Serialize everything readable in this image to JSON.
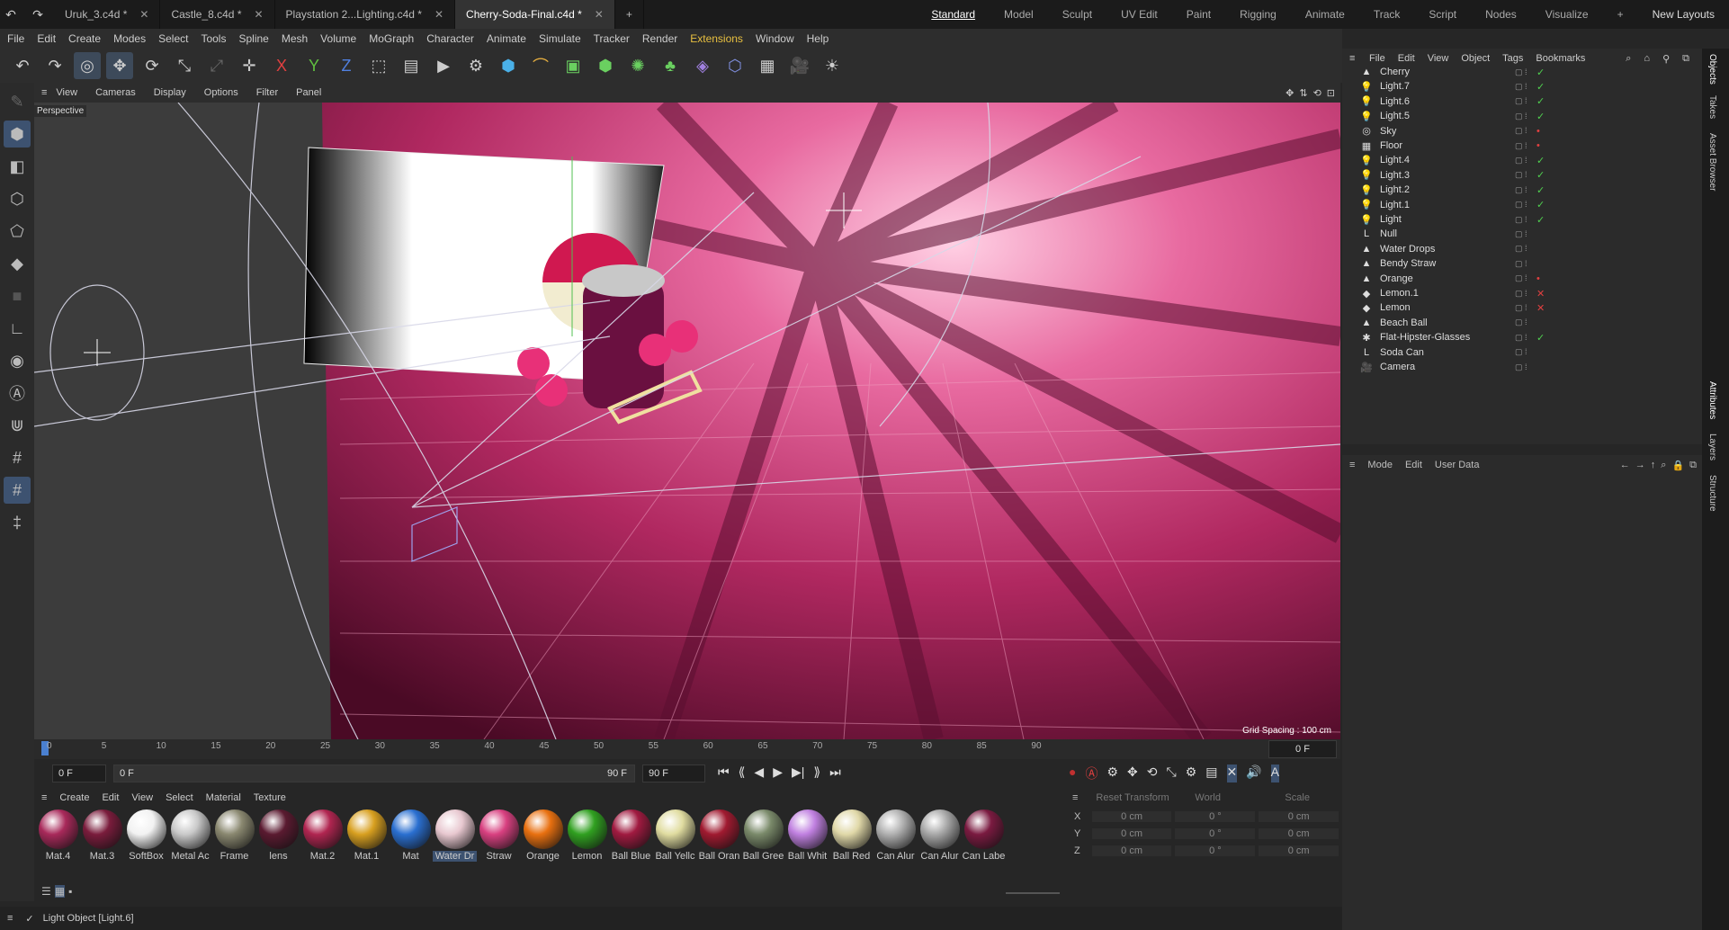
{
  "tabs": [
    {
      "label": "Uruk_3.c4d *"
    },
    {
      "label": "Castle_8.c4d *"
    },
    {
      "label": "Playstation 2...Lighting.c4d *"
    },
    {
      "label": "Cherry-Soda-Final.c4d *",
      "active": true
    }
  ],
  "layouts": [
    "Standard",
    "Model",
    "Sculpt",
    "UV Edit",
    "Paint",
    "Rigging",
    "Animate",
    "Track",
    "Script",
    "Nodes",
    "Visualize"
  ],
  "new_layouts": "New Layouts",
  "menu": [
    "File",
    "Edit",
    "Create",
    "Modes",
    "Select",
    "Tools",
    "Spline",
    "Mesh",
    "Volume",
    "MoGraph",
    "Character",
    "Animate",
    "Simulate",
    "Tracker",
    "Render",
    "Extensions",
    "Window",
    "Help"
  ],
  "toolbar_icons": [
    "undo-icon",
    "redo-icon",
    "live-select-icon",
    "move-icon",
    "rotate-icon",
    "scale-icon",
    "transform-icon",
    "axis-x-icon",
    "axis-y-icon",
    "axis-z-icon",
    "coordinate-system-icon",
    "render-view-icon",
    "render-picture-viewer-icon",
    "render-settings-icon",
    "cube-icon",
    "bend-icon",
    "subdivision-icon",
    "extrude-icon",
    "mograph-cloner-icon",
    "mograph-fracture-icon",
    "deformer-icon",
    "effector-icon",
    "grid-icon",
    "camera-icon",
    "light-icon"
  ],
  "viewport": {
    "menu": [
      "View",
      "Cameras",
      "Display",
      "Options",
      "Filter",
      "Panel"
    ],
    "camera_label": "Perspective",
    "grid_spacing": "Grid Spacing : 100 cm"
  },
  "timeline": {
    "ticks": [
      "0",
      "5",
      "10",
      "15",
      "20",
      "25",
      "30",
      "35",
      "40",
      "45",
      "50",
      "55",
      "60",
      "65",
      "70",
      "75",
      "80",
      "85",
      "90"
    ],
    "current": "0 F",
    "start": "0 F",
    "range_start": "0 F",
    "range_end": "90 F",
    "end": "90 F"
  },
  "material_menu": [
    "Create",
    "Edit",
    "View",
    "Select",
    "Material",
    "Texture"
  ],
  "materials": [
    {
      "label": "Mat.4",
      "color": "#a8295a"
    },
    {
      "label": "Mat.3",
      "color": "#7a1c3c"
    },
    {
      "label": "SoftBox",
      "color": "#f2f2f2"
    },
    {
      "label": "Metal Ac",
      "color": "#c9c9c9"
    },
    {
      "label": "Frame",
      "color": "#8a8870"
    },
    {
      "label": "lens",
      "color": "#5a1a30"
    },
    {
      "label": "Mat.2",
      "color": "#b02550"
    },
    {
      "label": "Mat.1",
      "color": "#d8a020"
    },
    {
      "label": "Mat",
      "color": "#2a6fd0"
    },
    {
      "label": "Water Dr",
      "color": "#e8c8d0"
    },
    {
      "label": "Straw",
      "color": "#d84080"
    },
    {
      "label": "Orange",
      "color": "#e87010"
    },
    {
      "label": "Lemon",
      "color": "#30a020"
    },
    {
      "label": "Ball Blue",
      "color": "#a01a40"
    },
    {
      "label": "Ball Yellc",
      "color": "#e0dca0"
    },
    {
      "label": "Ball Oran",
      "color": "#a01a30"
    },
    {
      "label": "Ball Gree",
      "color": "#7a8a6a"
    },
    {
      "label": "Ball Whit",
      "color": "#c080e0"
    },
    {
      "label": "Ball Red",
      "color": "#e0d8a8"
    },
    {
      "label": "Can Alur",
      "color": "#b0b0b0"
    },
    {
      "label": "Can Alur",
      "color": "#a8a8a8"
    },
    {
      "label": "Can Labe",
      "color": "#7a1a40"
    }
  ],
  "coords": {
    "reset": "Reset Transform",
    "world": "World",
    "scale": "Scale",
    "rows": [
      {
        "axis": "X",
        "p": "0 cm",
        "r": "0 °",
        "s": "0 cm"
      },
      {
        "axis": "Y",
        "p": "0 cm",
        "r": "0 °",
        "s": "0 cm"
      },
      {
        "axis": "Z",
        "p": "0 cm",
        "r": "0 °",
        "s": "0 cm"
      }
    ]
  },
  "status": "Light Object [Light.6]",
  "objects_menu": [
    "File",
    "Edit",
    "View",
    "Object",
    "Tags",
    "Bookmarks"
  ],
  "objects": [
    {
      "name": "Cherry",
      "icon": "▲",
      "tag": "check"
    },
    {
      "name": "Light.7",
      "icon": "💡",
      "tag": "check"
    },
    {
      "name": "Light.6",
      "icon": "💡",
      "tag": "check"
    },
    {
      "name": "Light.5",
      "icon": "💡",
      "tag": "check"
    },
    {
      "name": "Sky",
      "icon": "◎",
      "tag": "dot"
    },
    {
      "name": "Floor",
      "icon": "▦",
      "tag": "dot"
    },
    {
      "name": "Light.4",
      "icon": "💡",
      "tag": "check"
    },
    {
      "name": "Light.3",
      "icon": "💡",
      "tag": "check"
    },
    {
      "name": "Light.2",
      "icon": "💡",
      "tag": "check"
    },
    {
      "name": "Light.1",
      "icon": "💡",
      "tag": "check"
    },
    {
      "name": "Light",
      "icon": "💡",
      "tag": "check"
    },
    {
      "name": "Null",
      "icon": "L",
      "tag": ""
    },
    {
      "name": "Water Drops",
      "icon": "▲",
      "tag": ""
    },
    {
      "name": "Bendy Straw",
      "icon": "▲",
      "tag": ""
    },
    {
      "name": "Orange",
      "icon": "▲",
      "tag": "dot"
    },
    {
      "name": "Lemon.1",
      "icon": "◆",
      "tag": "x"
    },
    {
      "name": "Lemon",
      "icon": "◆",
      "tag": "x"
    },
    {
      "name": "Beach Ball",
      "icon": "▲",
      "tag": ""
    },
    {
      "name": "Flat-Hipster-Glasses",
      "icon": "✱",
      "tag": "check"
    },
    {
      "name": "Soda Can",
      "icon": "L",
      "tag": ""
    },
    {
      "name": "Camera",
      "icon": "🎥",
      "tag": ""
    }
  ],
  "attributes_menu": [
    "Mode",
    "Edit",
    "User Data"
  ],
  "right_tabs": [
    "Objects",
    "Takes",
    "Asset Browser",
    "Attributes",
    "Layers",
    "Structure"
  ]
}
